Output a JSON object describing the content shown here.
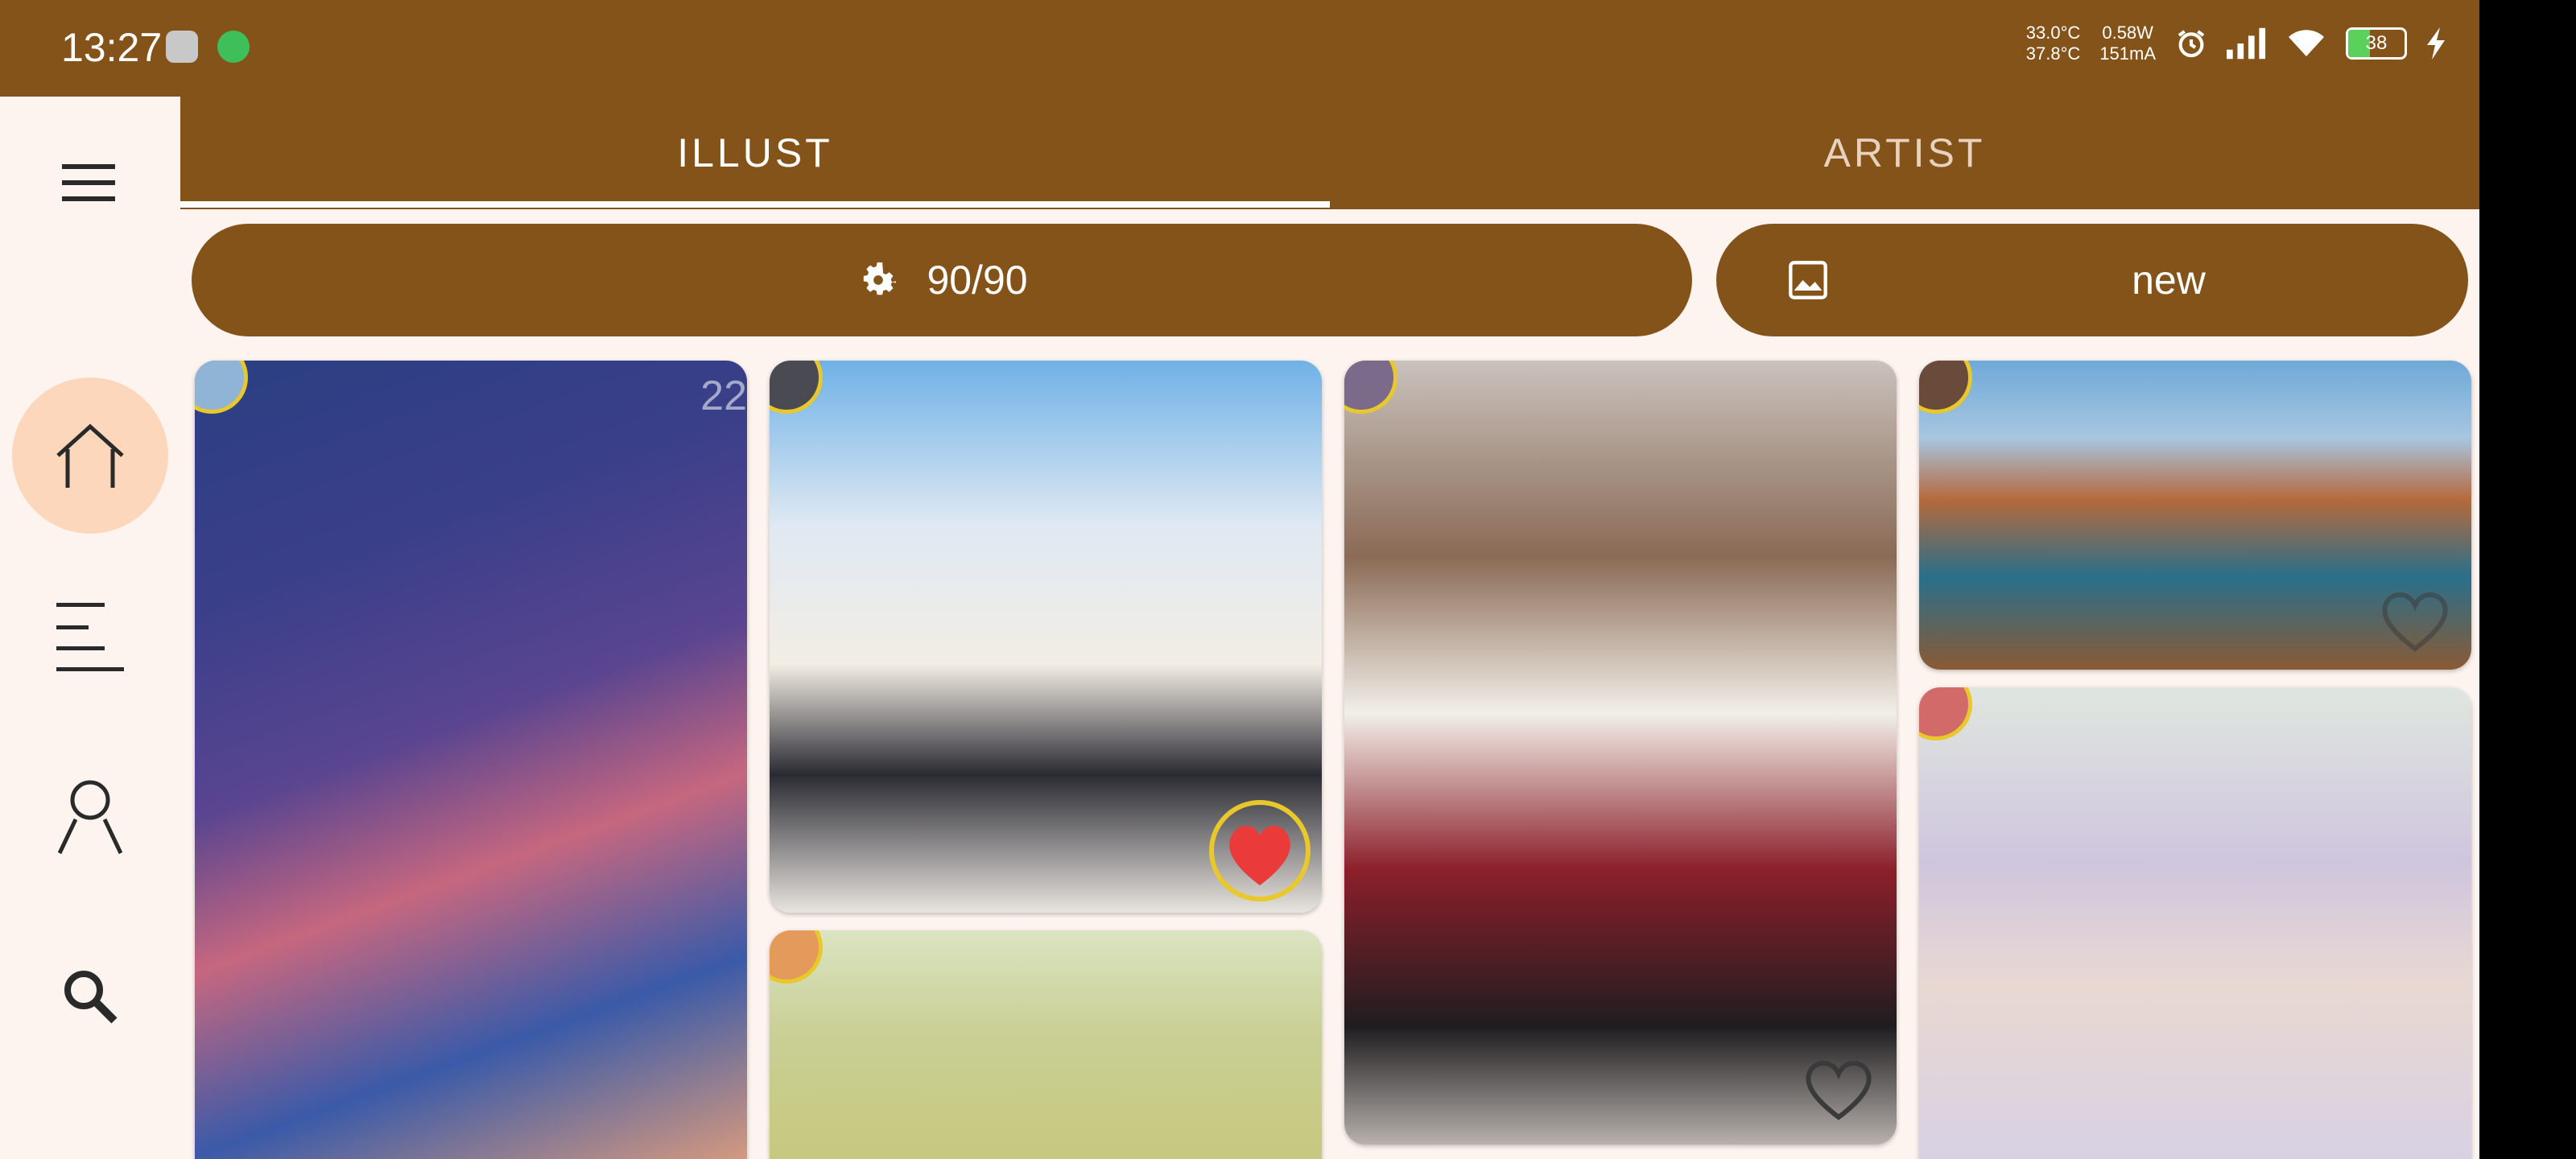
{
  "status_bar": {
    "time": "13:27",
    "temps": [
      "33.0°C",
      "37.8°C"
    ],
    "power": [
      "0.58W",
      "151mA"
    ],
    "battery": "38",
    "icons": [
      "alarm-icon",
      "signal-icon",
      "wifi-icon",
      "battery-icon",
      "charging-icon"
    ]
  },
  "nav_rail": {
    "items": [
      {
        "name": "menu-icon"
      },
      {
        "name": "home-icon",
        "active": true
      },
      {
        "name": "list-icon"
      },
      {
        "name": "person-icon"
      },
      {
        "name": "search-icon"
      }
    ]
  },
  "tabs": [
    {
      "label": "ILLUST",
      "active": true
    },
    {
      "label": "ARTIST",
      "active": false
    }
  ],
  "filter_button": {
    "label": "90/90",
    "icon": "gear-icon"
  },
  "type_button": {
    "label": "new",
    "icon": "image-icon"
  },
  "feed": {
    "cards": [
      {
        "id": "sky",
        "count": "22",
        "liked": false
      },
      {
        "id": "girl-clouds",
        "liked": true
      },
      {
        "id": "girl-field",
        "liked": false
      },
      {
        "id": "girl-bed",
        "liked": false
      },
      {
        "id": "canyon",
        "liked": false
      },
      {
        "id": "wreath-girl",
        "liked": false
      }
    ]
  },
  "colors": {
    "primary": "#83531a",
    "surface": "#fdf4ef",
    "active_pill": "#fdd7bc",
    "heart": "#ea3a3a",
    "avatar_ring": "#e8c82a"
  }
}
